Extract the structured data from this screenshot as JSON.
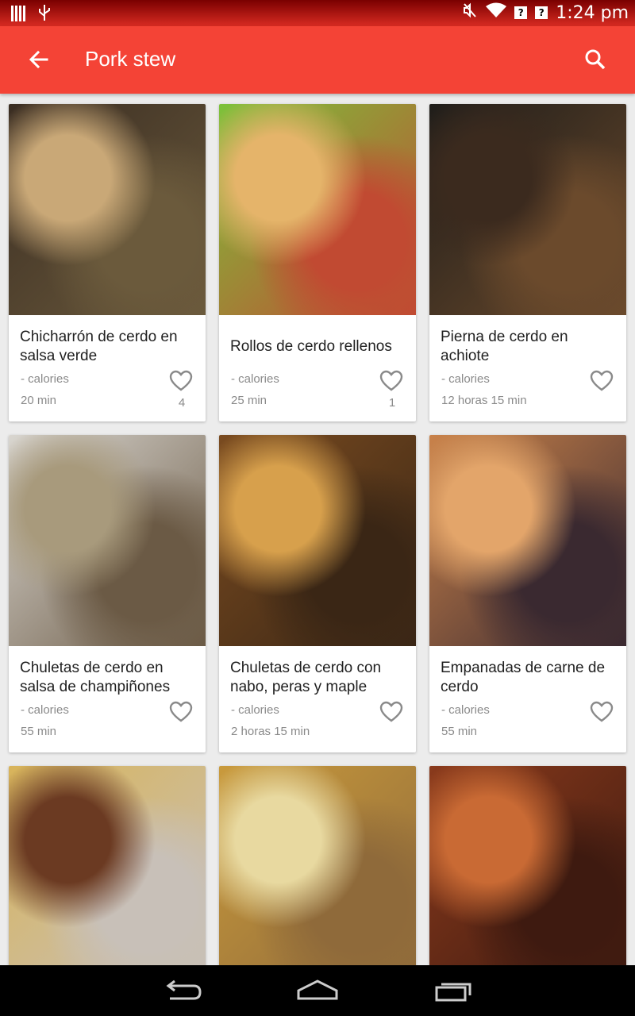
{
  "status_bar": {
    "time": "1:24 pm"
  },
  "app_bar": {
    "title": "Pork stew"
  },
  "recipes": [
    {
      "name": "Chicharrón de cerdo en salsa verde",
      "calories": "- calories",
      "time": "20 min",
      "likes": "4",
      "palette": [
        "#3a2d22",
        "#c9a877",
        "#6b5a3c"
      ]
    },
    {
      "name": "Rollos de cerdo rellenos",
      "calories": "- calories",
      "time": "25 min",
      "likes": "1",
      "palette": [
        "#7cc23a",
        "#e5b46a",
        "#c14a32"
      ]
    },
    {
      "name": "Pierna de cerdo en achiote",
      "calories": "- calories",
      "time": "12 horas 15 min",
      "likes": "",
      "palette": [
        "#1f1d1a",
        "#3b2a1e",
        "#6b4a2c"
      ]
    },
    {
      "name": "Chuletas de cerdo en salsa de champiñones",
      "calories": "- calories",
      "time": "55 min",
      "likes": "",
      "palette": [
        "#d9d6d0",
        "#a89a7c",
        "#6b5a45"
      ]
    },
    {
      "name": "Chuletas de cerdo con nabo, peras y maple",
      "calories": "- calories",
      "time": "2 horas 15 min",
      "likes": "",
      "palette": [
        "#7a4b20",
        "#d7a04c",
        "#3a2615"
      ]
    },
    {
      "name": "Empanadas de carne de cerdo",
      "calories": "- calories",
      "time": "55 min",
      "likes": "",
      "palette": [
        "#c9824a",
        "#e3a56a",
        "#3a2930"
      ]
    },
    {
      "name": "",
      "calories": "",
      "time": "",
      "likes": "",
      "palette": [
        "#d8b45a",
        "#6b3a22",
        "#c8c0b8"
      ]
    },
    {
      "name": "",
      "calories": "",
      "time": "",
      "likes": "",
      "palette": [
        "#c99a3c",
        "#e8d9a0",
        "#8f6a3a"
      ]
    },
    {
      "name": "",
      "calories": "",
      "time": "",
      "likes": "",
      "palette": [
        "#8a3a1c",
        "#c96a34",
        "#3e1a10"
      ]
    }
  ]
}
